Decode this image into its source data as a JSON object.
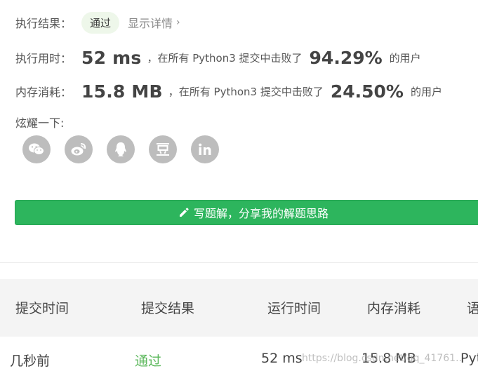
{
  "result": {
    "label": "执行结果：",
    "status": "通过",
    "details_link": "显示详情",
    "chevron": "›"
  },
  "runtime": {
    "label": "执行用时：",
    "value": "52 ms",
    "middle_text": "，在所有 Python3 提交中击败了",
    "percent": "94.29%",
    "tail_text": "的用户"
  },
  "memory": {
    "label": "内存消耗：",
    "value": "15.8 MB",
    "middle_text": "，在所有 Python3 提交中击败了",
    "percent": "24.50%",
    "tail_text": "的用户"
  },
  "share": {
    "label": "炫耀一下:",
    "icons": [
      "wechat-icon",
      "weibo-icon",
      "qq-icon",
      "douban-icon",
      "linkedin-icon"
    ]
  },
  "write_solution": {
    "label": "写题解，分享我的解题思路",
    "icon": "pencil-icon"
  },
  "table": {
    "headers": [
      "提交时间",
      "提交结果",
      "运行时间",
      "内存消耗",
      "语"
    ],
    "row": [
      "几秒前",
      "通过",
      "52 ms",
      "15.8 MB",
      "Pyt"
    ]
  },
  "watermark": "https://blog.csdn.net/qq_41761..",
  "colors": {
    "accent_green": "#2db55d",
    "pass_green": "#5cb85c",
    "badge_bg": "#eef7ea",
    "icon_gray": "#bdbdbd"
  }
}
